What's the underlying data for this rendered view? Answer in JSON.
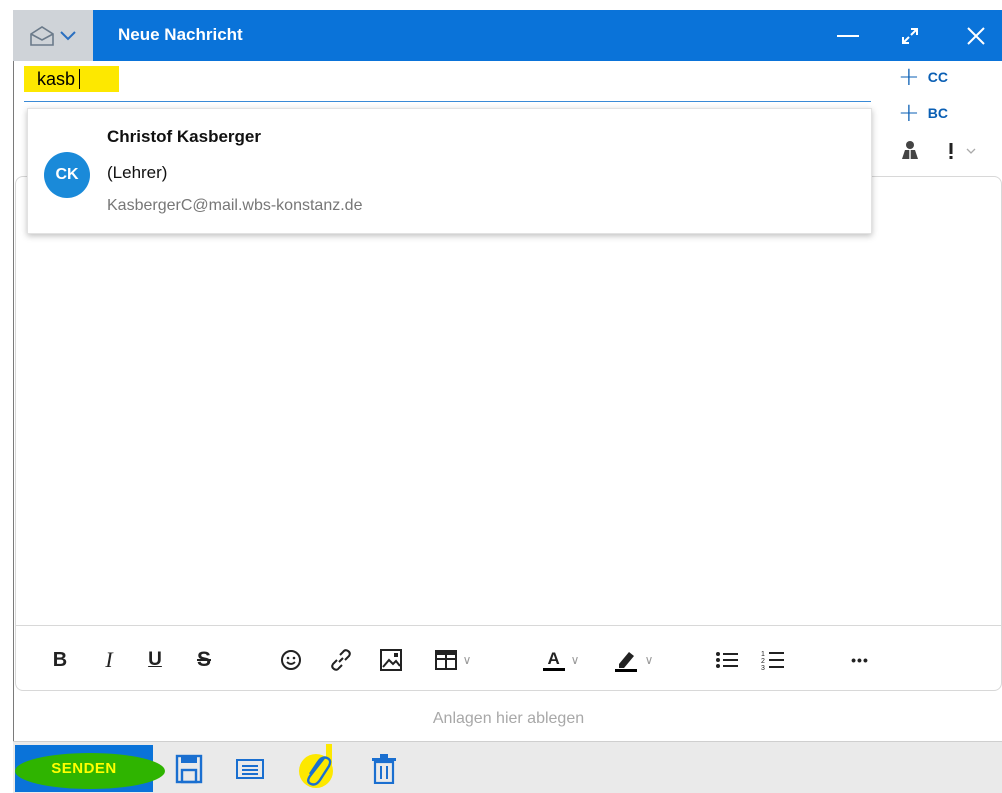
{
  "window": {
    "title": "Neue Nachricht"
  },
  "compose": {
    "to_value": "kasb",
    "cc_label": "CC",
    "bc_label": "BC"
  },
  "suggestion": {
    "initials": "CK",
    "name": "Christof Kasberger",
    "role": "(Lehrer)",
    "email": "KasbergerC@mail.wbs-konstanz.de"
  },
  "toolbar": {
    "bold": "B",
    "italic": "I",
    "underline": "U",
    "strike": "S",
    "font_color": "A",
    "more": "•••"
  },
  "attachments": {
    "drop_text": "Anlagen hier ablegen"
  },
  "actions": {
    "send_label": "SENDEN"
  },
  "colors": {
    "accent": "#0a73d9",
    "highlight_yellow": "#fde800",
    "highlight_green": "#2fb400",
    "avatar": "#1a8ad9"
  }
}
